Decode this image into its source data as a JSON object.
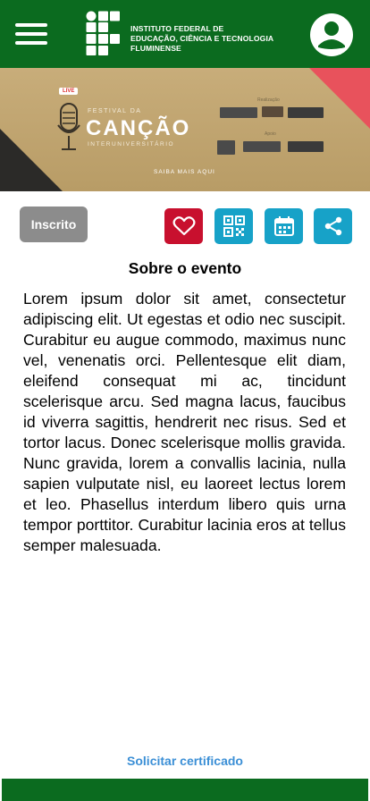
{
  "header": {
    "logo_text_line1": "INSTITUTO FEDERAL DE",
    "logo_text_line2": "EDUCAÇÃO, CIÊNCIA E TECNOLOGIA",
    "logo_text_line3": "FLUMINENSE",
    "menu_icon": "hamburger-menu-icon",
    "profile_icon": "user-avatar-icon",
    "background_color": "#0b6b1f"
  },
  "banner": {
    "live_badge": "LIVE",
    "festival": "FESTIVAL DA",
    "title": "CANÇÃO",
    "subtitle": "INTERUNIVERSITÁRIO",
    "cta": "SAIBA MAIS AQUI",
    "realizacao": "Realização",
    "apoio": "Apoio"
  },
  "actions": {
    "inscrito_label": "Inscrito",
    "favorite_icon": "heart-icon",
    "qr_icon": "qr-code-icon",
    "calendar_icon": "calendar-icon",
    "share_icon": "share-icon",
    "favorite_color": "#c8102e",
    "accent_color": "#17a2c8"
  },
  "content": {
    "section_title": "Sobre o evento",
    "description": "Lorem ipsum dolor sit amet, consectetur adipiscing elit. Ut egestas et odio nec suscipit. Curabitur eu augue commodo, maximus nunc vel, venenatis orci. Pellentesque elit diam, eleifend consequat mi ac, tincidunt scelerisque arcu. Sed magna lacus, faucibus id viverra sagittis, hendrerit nec risus. Sed et tortor lacus. Donec scelerisque mollis gravida. Nunc gravida, lorem a convallis lacinia, nulla sapien vulputate nisl, eu laoreet lectus lorem et leo. Phasellus interdum libero quis urna tempor porttitor. Curabitur lacinia eros at tellus semper malesuada."
  },
  "footer": {
    "certificate_link": "Solicitar certificado"
  }
}
